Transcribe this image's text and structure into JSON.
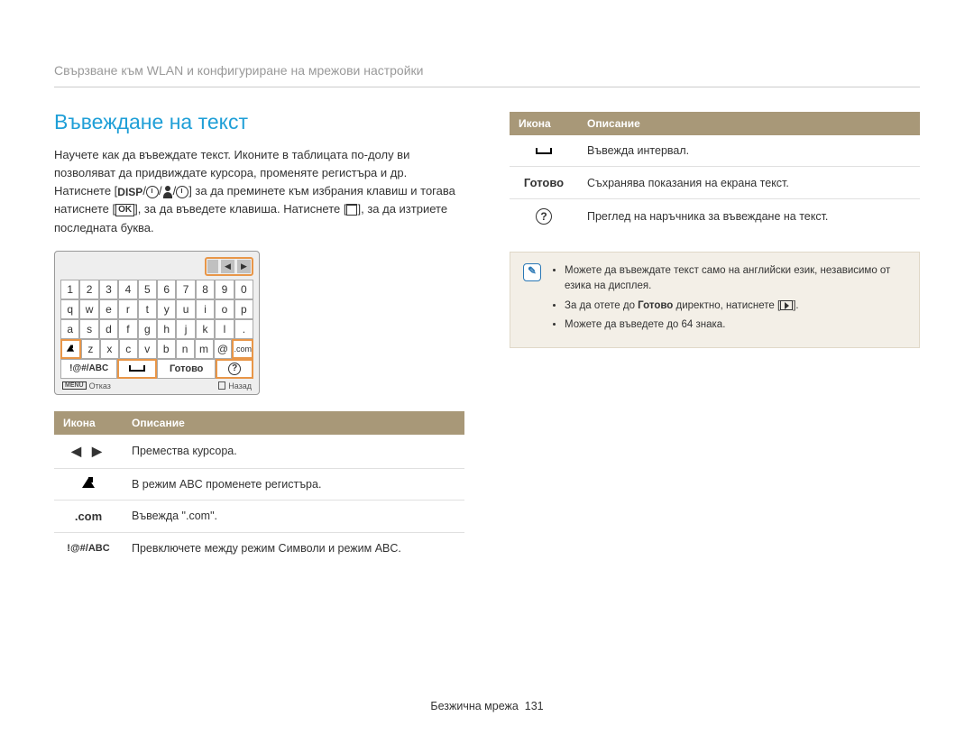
{
  "header": "Свързване към WLAN и конфигуриране на мрежови настройки",
  "section_title": "Въвеждане на текст",
  "paragraph_parts": {
    "p1": "Научете как да въвеждате текст. Иконите в таблицата по-долу ви позволяват да придвиждате курсора, променяте регистъра и др. Натиснете [",
    "p2": "] за да преминете към избрания клавиш и тогава натиснете [",
    "p3": "], за да въведете клавиша. Натиснете [",
    "p4": "], за да изтриете последната буква."
  },
  "keyboard": {
    "rows": [
      [
        "1",
        "2",
        "3",
        "4",
        "5",
        "6",
        "7",
        "8",
        "9",
        "0"
      ],
      [
        "q",
        "w",
        "e",
        "r",
        "t",
        "y",
        "u",
        "i",
        "o",
        "p"
      ],
      [
        "a",
        "s",
        "d",
        "f",
        "g",
        "h",
        "j",
        "k",
        "l",
        "."
      ],
      [
        "",
        "z",
        "x",
        "c",
        "v",
        "b",
        "n",
        "m",
        "@",
        ".com"
      ]
    ],
    "bottom": {
      "abc": "!@#/ABC",
      "done": "Готово"
    },
    "footer": {
      "menu": "MENU",
      "cancel": "Отказ",
      "back": "Назад"
    }
  },
  "table_left": {
    "headers": {
      "icon": "Икона",
      "desc": "Описание"
    },
    "rows": [
      {
        "icon_type": "arrows",
        "desc": "Премества курсора."
      },
      {
        "icon_type": "shift",
        "desc": "В режим ABC променете регистъра."
      },
      {
        "icon_type": "com",
        "icon_text": ".com",
        "desc": "Въвежда \".com\"."
      },
      {
        "icon_type": "abc",
        "icon_text": "!@#/ABC",
        "desc": "Превключете между режим Символи и режим ABC."
      }
    ]
  },
  "table_right": {
    "headers": {
      "icon": "Икона",
      "desc": "Описание"
    },
    "rows": [
      {
        "icon_type": "space",
        "desc": "Въвежда интервал."
      },
      {
        "icon_type": "done",
        "icon_text": "Готово",
        "desc": "Съхранява показания на екрана текст."
      },
      {
        "icon_type": "help",
        "desc": "Преглед на наръчника за въвеждане на текст."
      }
    ]
  },
  "note": {
    "items": [
      {
        "pre": "Можете да въвеждате текст само на английски език, независимо от езика на дисплея."
      },
      {
        "pre": "За да отете до ",
        "bold": "Готово",
        "post": " директно, натиснете [",
        "has_play": true,
        "tail": "]."
      },
      {
        "pre": "Можете да въведете до 64 знака."
      }
    ]
  },
  "footer": {
    "label": "Безжична мрежа",
    "page": "131"
  }
}
